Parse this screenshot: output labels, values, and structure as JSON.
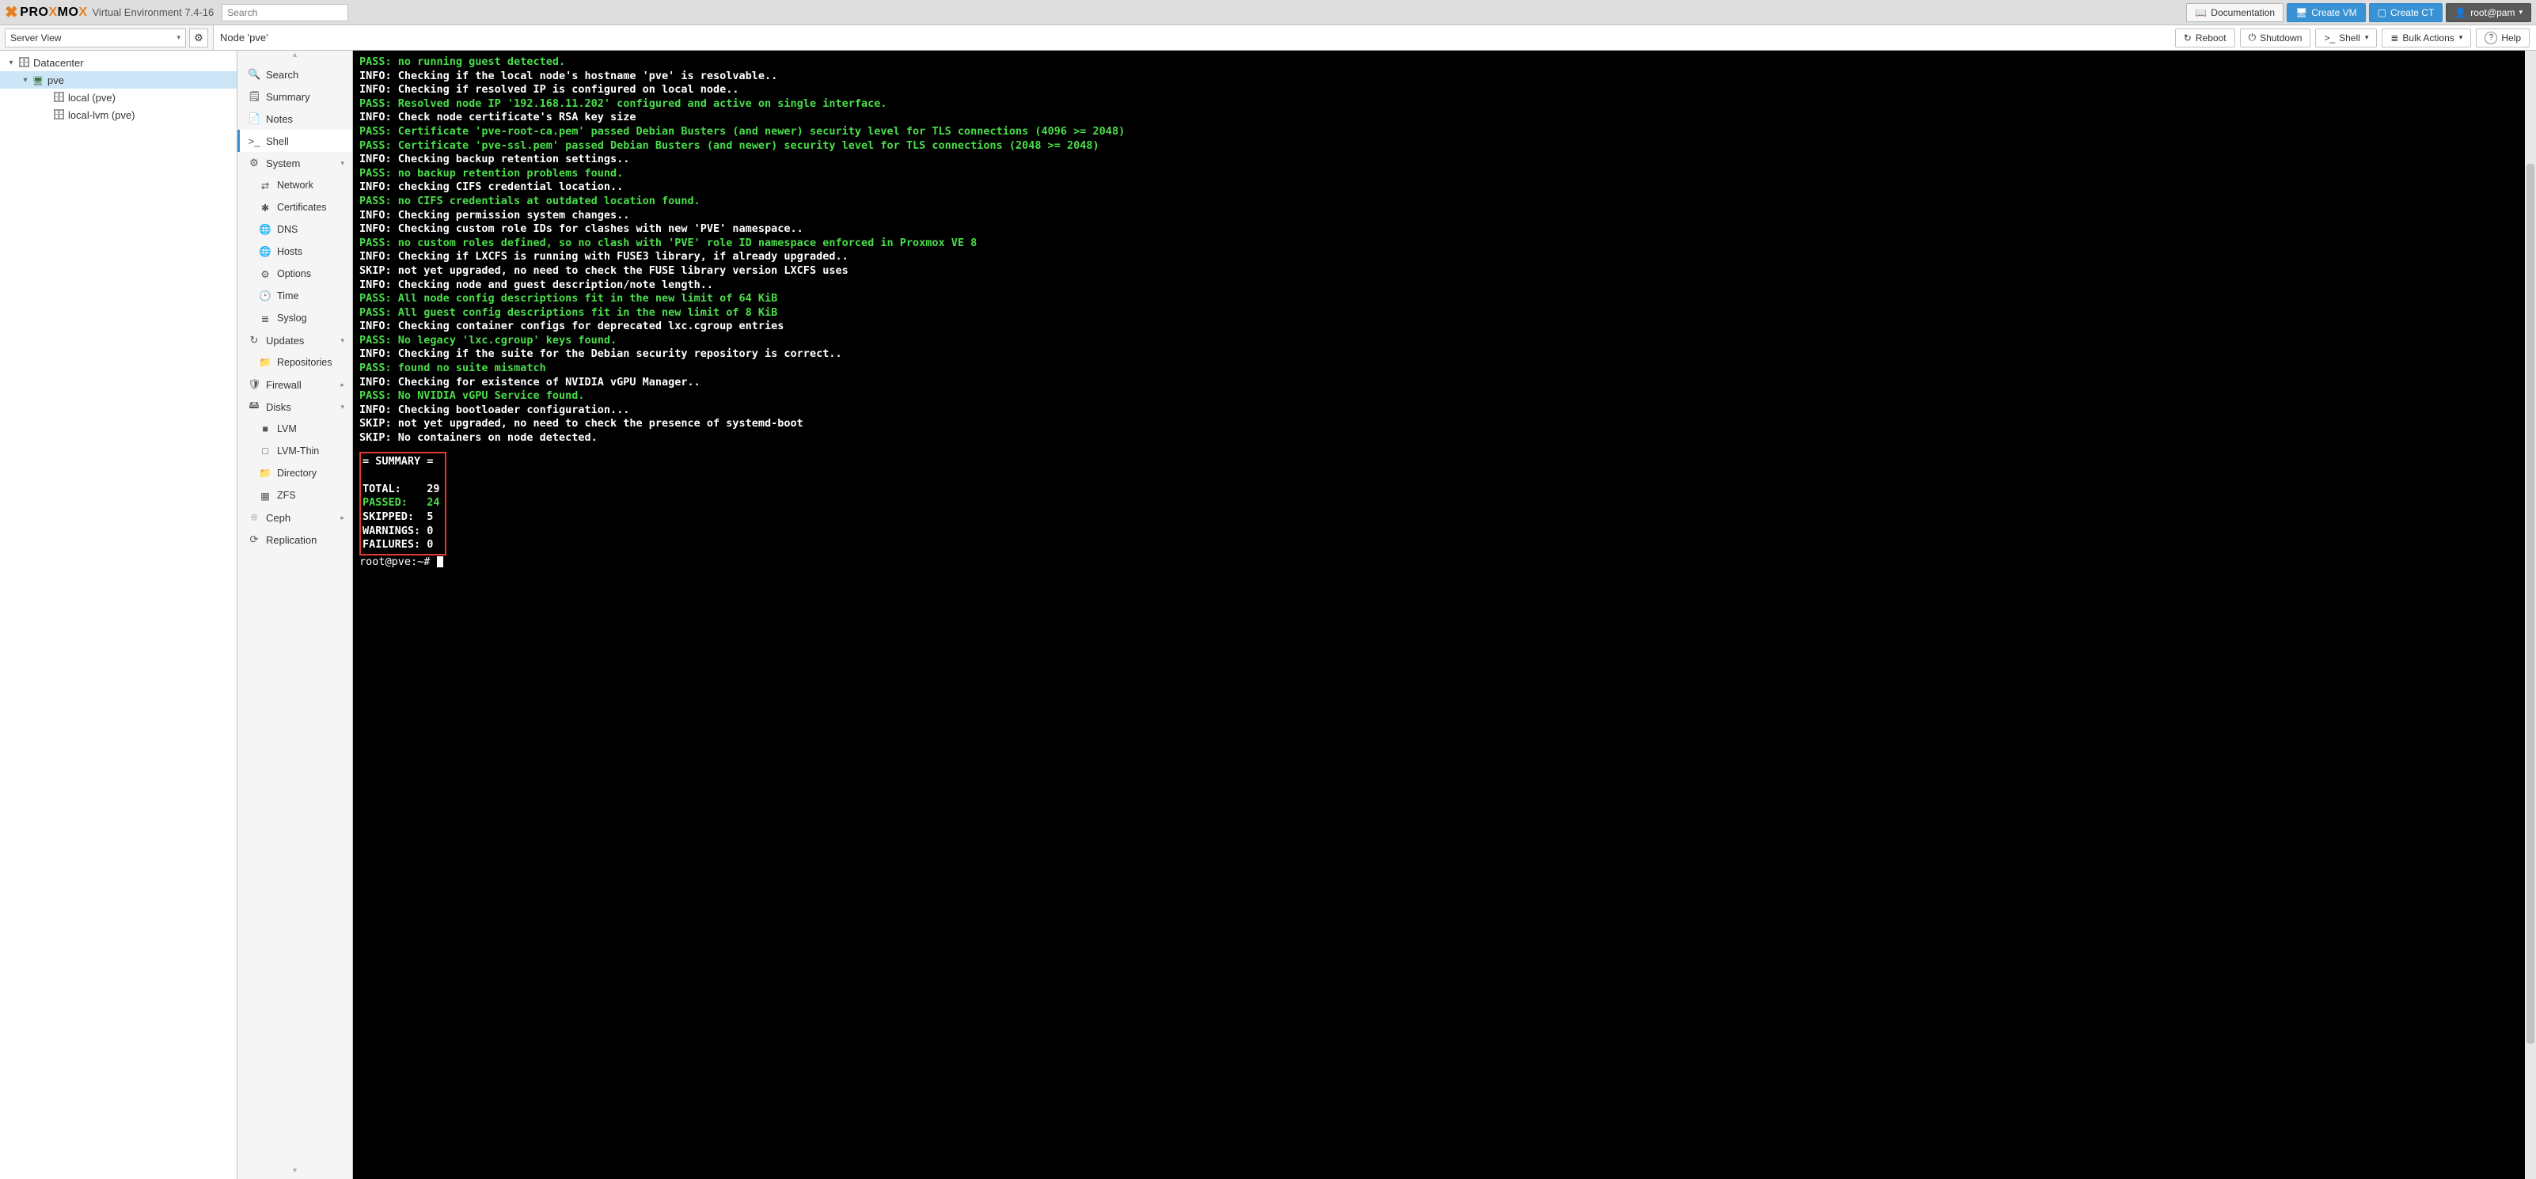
{
  "brand": {
    "text": "PROXMOX",
    "ve_label": "Virtual Environment 7.4-16"
  },
  "search": {
    "placeholder": "Search"
  },
  "topbar": {
    "doc": "Documentation",
    "create_vm": "Create VM",
    "create_ct": "Create CT",
    "user": "root@pam"
  },
  "view_selector": {
    "value": "Server View"
  },
  "node_toolbar": {
    "title": "Node 'pve'",
    "reboot": "Reboot",
    "shutdown": "Shutdown",
    "shell": "Shell",
    "bulk": "Bulk Actions",
    "help": "Help"
  },
  "tree": {
    "datacenter": "Datacenter",
    "pve": "pve",
    "local": "local (pve)",
    "local_lvm": "local-lvm (pve)"
  },
  "menu": {
    "search": "Search",
    "summary": "Summary",
    "notes": "Notes",
    "shell": "Shell",
    "system": "System",
    "network": "Network",
    "certificates": "Certificates",
    "dns": "DNS",
    "hosts": "Hosts",
    "options": "Options",
    "time": "Time",
    "syslog": "Syslog",
    "updates": "Updates",
    "repositories": "Repositories",
    "firewall": "Firewall",
    "disks": "Disks",
    "lvm": "LVM",
    "lvm_thin": "LVM-Thin",
    "directory": "Directory",
    "zfs": "ZFS",
    "ceph": "Ceph",
    "replication": "Replication"
  },
  "terminal": {
    "lines": [
      {
        "lvl": "PASS",
        "txt": "no running guest detected."
      },
      {
        "lvl": "INFO",
        "txt": "Checking if the local node's hostname 'pve' is resolvable.."
      },
      {
        "lvl": "INFO",
        "txt": "Checking if resolved IP is configured on local node.."
      },
      {
        "lvl": "PASS",
        "txt": "Resolved node IP '192.168.11.202' configured and active on single interface."
      },
      {
        "lvl": "INFO",
        "txt": "Check node certificate's RSA key size"
      },
      {
        "lvl": "PASS",
        "txt": "Certificate 'pve-root-ca.pem' passed Debian Busters (and newer) security level for TLS connections (4096 >= 2048)"
      },
      {
        "lvl": "PASS",
        "txt": "Certificate 'pve-ssl.pem' passed Debian Busters (and newer) security level for TLS connections (2048 >= 2048)"
      },
      {
        "lvl": "INFO",
        "txt": "Checking backup retention settings.."
      },
      {
        "lvl": "PASS",
        "txt": "no backup retention problems found."
      },
      {
        "lvl": "INFO",
        "txt": "checking CIFS credential location.."
      },
      {
        "lvl": "PASS",
        "txt": "no CIFS credentials at outdated location found."
      },
      {
        "lvl": "INFO",
        "txt": "Checking permission system changes.."
      },
      {
        "lvl": "INFO",
        "txt": "Checking custom role IDs for clashes with new 'PVE' namespace.."
      },
      {
        "lvl": "PASS",
        "txt": "no custom roles defined, so no clash with 'PVE' role ID namespace enforced in Proxmox VE 8"
      },
      {
        "lvl": "INFO",
        "txt": "Checking if LXCFS is running with FUSE3 library, if already upgraded.."
      },
      {
        "lvl": "SKIP",
        "txt": "not yet upgraded, no need to check the FUSE library version LXCFS uses"
      },
      {
        "lvl": "INFO",
        "txt": "Checking node and guest description/note length.."
      },
      {
        "lvl": "PASS",
        "txt": "All node config descriptions fit in the new limit of 64 KiB"
      },
      {
        "lvl": "PASS",
        "txt": "All guest config descriptions fit in the new limit of 8 KiB"
      },
      {
        "lvl": "INFO",
        "txt": "Checking container configs for deprecated lxc.cgroup entries"
      },
      {
        "lvl": "PASS",
        "txt": "No legacy 'lxc.cgroup' keys found."
      },
      {
        "lvl": "INFO",
        "txt": "Checking if the suite for the Debian security repository is correct.."
      },
      {
        "lvl": "PASS",
        "txt": "found no suite mismatch"
      },
      {
        "lvl": "INFO",
        "txt": "Checking for existence of NVIDIA vGPU Manager.."
      },
      {
        "lvl": "PASS",
        "txt": "No NVIDIA vGPU Service found."
      },
      {
        "lvl": "INFO",
        "txt": "Checking bootloader configuration..."
      },
      {
        "lvl": "SKIP",
        "txt": "not yet upgraded, no need to check the presence of systemd-boot"
      },
      {
        "lvl": "SKIP",
        "txt": "No containers on node detected."
      }
    ],
    "summary": {
      "header": "= SUMMARY =",
      "rows": [
        {
          "k": "TOTAL:",
          "v": "29",
          "cls": ""
        },
        {
          "k": "PASSED:",
          "v": "24",
          "cls": "PASSED"
        },
        {
          "k": "SKIPPED:",
          "v": "5",
          "cls": ""
        },
        {
          "k": "WARNINGS:",
          "v": "0",
          "cls": ""
        },
        {
          "k": "FAILURES:",
          "v": "0",
          "cls": ""
        }
      ]
    },
    "prompt": "root@pve:~# "
  }
}
